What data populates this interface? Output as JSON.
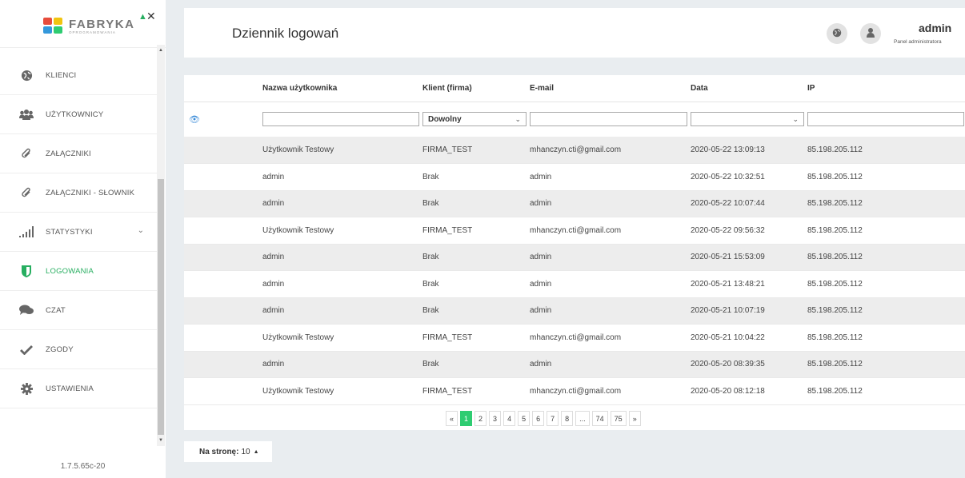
{
  "sidebar": {
    "logo_text": "FABRYKA",
    "logo_sub": "OPROGRAMOWANIA",
    "items": [
      {
        "label": "KLIENCI",
        "icon": "globe-icon"
      },
      {
        "label": "UŻYTKOWNICY",
        "icon": "users-icon"
      },
      {
        "label": "ZAŁĄCZNIKI",
        "icon": "paperclip-icon"
      },
      {
        "label": "ZAŁĄCZNIKI - SŁOWNIK",
        "icon": "paperclip-icon"
      },
      {
        "label": "STATYSTYKI",
        "icon": "signal-bars-icon"
      },
      {
        "label": "LOGOWANIA",
        "icon": "shield-icon"
      },
      {
        "label": "CZAT",
        "icon": "chat-icon"
      },
      {
        "label": "ZGODY",
        "icon": "check-icon"
      },
      {
        "label": "USTAWIENIA",
        "icon": "gear-icon"
      }
    ],
    "active_item": "LOGOWANIA",
    "version": "1.7.5.65c-20"
  },
  "header": {
    "title": "Dziennik logowań",
    "user_name": "admin",
    "user_role": "Panel administratora"
  },
  "table": {
    "columns": [
      "Nazwa użytkownika",
      "Klient (firma)",
      "E-mail",
      "Data",
      "IP"
    ],
    "filter": {
      "client_select": "Dowolny"
    },
    "rows": [
      [
        "Użytkownik Testowy",
        "FIRMA_TEST",
        "mhanczyn.cti@gmail.com",
        "2020-05-22 13:09:13",
        "85.198.205.112"
      ],
      [
        "admin",
        "Brak",
        "admin",
        "2020-05-22 10:32:51",
        "85.198.205.112"
      ],
      [
        "admin",
        "Brak",
        "admin",
        "2020-05-22 10:07:44",
        "85.198.205.112"
      ],
      [
        "Użytkownik Testowy",
        "FIRMA_TEST",
        "mhanczyn.cti@gmail.com",
        "2020-05-22 09:56:32",
        "85.198.205.112"
      ],
      [
        "admin",
        "Brak",
        "admin",
        "2020-05-21 15:53:09",
        "85.198.205.112"
      ],
      [
        "admin",
        "Brak",
        "admin",
        "2020-05-21 13:48:21",
        "85.198.205.112"
      ],
      [
        "admin",
        "Brak",
        "admin",
        "2020-05-21 10:07:19",
        "85.198.205.112"
      ],
      [
        "Użytkownik Testowy",
        "FIRMA_TEST",
        "mhanczyn.cti@gmail.com",
        "2020-05-21 10:04:22",
        "85.198.205.112"
      ],
      [
        "admin",
        "Brak",
        "admin",
        "2020-05-20 08:39:35",
        "85.198.205.112"
      ],
      [
        "Użytkownik Testowy",
        "FIRMA_TEST",
        "mhanczyn.cti@gmail.com",
        "2020-05-20 08:12:18",
        "85.198.205.112"
      ]
    ]
  },
  "pagination": {
    "pages": [
      "«",
      "1",
      "2",
      "3",
      "4",
      "5",
      "6",
      "7",
      "8",
      "...",
      "74",
      "75",
      "»"
    ],
    "current": "1"
  },
  "per_page": {
    "label": "Na stronę:",
    "value": "10"
  },
  "colors": {
    "accent": "#27ae60",
    "active_page": "#2ecc71"
  }
}
